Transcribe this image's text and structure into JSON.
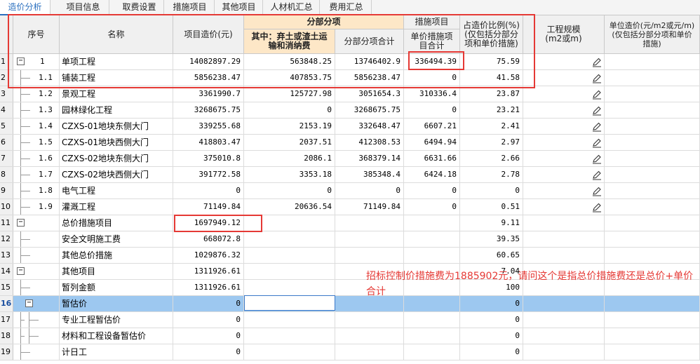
{
  "tabs": [
    {
      "label": "造价分析",
      "active": true
    },
    {
      "label": "项目信息",
      "active": false
    },
    {
      "label": "取费设置",
      "active": false
    },
    {
      "label": "措施项目",
      "active": false
    },
    {
      "label": "其他项目",
      "active": false
    },
    {
      "label": "人材机汇总",
      "active": false
    },
    {
      "label": "费用汇总",
      "active": false
    }
  ],
  "headers": {
    "seq": "序号",
    "name": "名称",
    "project_cost": "项目造价(元)",
    "fbfx_group": "分部分项",
    "fbfx_sub1": "其中：弃土或渣土运输和消纳费",
    "fbfx_sub2": "分部分项合计",
    "measure_group": "措施项目",
    "measure_sub": "单价措施项目合计",
    "ratio": "占造价比例(%)(仅包括分部分项和单价措施)",
    "scale": "工程规模(m2或m)",
    "unit_cost": "单位造价(元/m2或元/m)(仅包括分部分项和单价措施)"
  },
  "rows": [
    {
      "n": "1",
      "seq": "1",
      "name": "单项工程",
      "cost": "14082897.29",
      "qitu": "563848.25",
      "fbfx": "13746402.9",
      "measure": "336494.39",
      "ratio": "75.59",
      "edit": true,
      "toggle": "−",
      "level": 0
    },
    {
      "n": "2",
      "seq": "1.1",
      "name": "铺装工程",
      "cost": "5856238.47",
      "qitu": "407853.75",
      "fbfx": "5856238.47",
      "measure": "0",
      "ratio": "41.58",
      "edit": true,
      "level": 1
    },
    {
      "n": "3",
      "seq": "1.2",
      "name": "景观工程",
      "cost": "3361990.7",
      "qitu": "125727.98",
      "fbfx": "3051654.3",
      "measure": "310336.4",
      "ratio": "23.87",
      "edit": true,
      "level": 1
    },
    {
      "n": "4",
      "seq": "1.3",
      "name": "园林绿化工程",
      "cost": "3268675.75",
      "qitu": "0",
      "fbfx": "3268675.75",
      "measure": "0",
      "ratio": "23.21",
      "edit": true,
      "level": 1
    },
    {
      "n": "5",
      "seq": "1.4",
      "name": "CZXS-01地块东侧大门",
      "cost": "339255.68",
      "qitu": "2153.19",
      "fbfx": "332648.47",
      "measure": "6607.21",
      "ratio": "2.41",
      "edit": true,
      "level": 1
    },
    {
      "n": "6",
      "seq": "1.5",
      "name": "CZXS-01地块西侧大门",
      "cost": "418803.47",
      "qitu": "2037.51",
      "fbfx": "412308.53",
      "measure": "6494.94",
      "ratio": "2.97",
      "edit": true,
      "level": 1
    },
    {
      "n": "7",
      "seq": "1.6",
      "name": "CZXS-02地块东侧大门",
      "cost": "375010.8",
      "qitu": "2086.1",
      "fbfx": "368379.14",
      "measure": "6631.66",
      "ratio": "2.66",
      "edit": true,
      "level": 1
    },
    {
      "n": "8",
      "seq": "1.7",
      "name": "CZXS-02地块西侧大门",
      "cost": "391772.58",
      "qitu": "3353.18",
      "fbfx": "385348.4",
      "measure": "6424.18",
      "ratio": "2.78",
      "edit": true,
      "level": 1
    },
    {
      "n": "9",
      "seq": "1.8",
      "name": "电气工程",
      "cost": "0",
      "qitu": "0",
      "fbfx": "0",
      "measure": "0",
      "ratio": "0",
      "edit": true,
      "level": 1
    },
    {
      "n": "10",
      "seq": "1.9",
      "name": "灌溉工程",
      "cost": "71149.84",
      "qitu": "20636.54",
      "fbfx": "71149.84",
      "measure": "0",
      "ratio": "0.51",
      "edit": true,
      "level": 1
    },
    {
      "n": "11",
      "seq": "",
      "name": "总价措施项目",
      "cost": "1697949.12",
      "qitu": "",
      "fbfx": "",
      "measure": "",
      "ratio": "9.11",
      "edit": false,
      "toggle": "−",
      "level": 0
    },
    {
      "n": "12",
      "seq": "",
      "name": "安全文明施工费",
      "cost": "668072.8",
      "qitu": "",
      "fbfx": "",
      "measure": "",
      "ratio": "39.35",
      "edit": false,
      "level": 1
    },
    {
      "n": "13",
      "seq": "",
      "name": "其他总价措施",
      "cost": "1029876.32",
      "qitu": "",
      "fbfx": "",
      "measure": "",
      "ratio": "60.65",
      "edit": false,
      "level": 1
    },
    {
      "n": "14",
      "seq": "",
      "name": "其他项目",
      "cost": "1311926.61",
      "qitu": "",
      "fbfx": "",
      "measure": "",
      "ratio": "7.04",
      "edit": false,
      "toggle": "−",
      "level": 0
    },
    {
      "n": "15",
      "seq": "",
      "name": "暂列金额",
      "cost": "1311926.61",
      "qitu": "",
      "fbfx": "",
      "measure": "",
      "ratio": "100",
      "edit": false,
      "level": 1
    },
    {
      "n": "16",
      "seq": "",
      "name": "暂估价",
      "cost": "0",
      "qitu": "",
      "fbfx": "",
      "measure": "",
      "ratio": "0",
      "edit": false,
      "toggle": "−",
      "level": 1,
      "selected": true
    },
    {
      "n": "17",
      "seq": "",
      "name": "专业工程暂估价",
      "cost": "0",
      "qitu": "",
      "fbfx": "",
      "measure": "",
      "ratio": "0",
      "edit": false,
      "level": 2
    },
    {
      "n": "18",
      "seq": "",
      "name": "材料和工程设备暂估价",
      "cost": "0",
      "qitu": "",
      "fbfx": "",
      "measure": "",
      "ratio": "0",
      "edit": false,
      "level": 2
    },
    {
      "n": "19",
      "seq": "",
      "name": "计日工",
      "cost": "0",
      "qitu": "",
      "fbfx": "",
      "measure": "",
      "ratio": "0",
      "edit": false,
      "level": 1
    }
  ],
  "annotation": "招标控制价措施费为1885902元，请问这个是指总价措施费还是总价+单价合计",
  "colors": {
    "accent": "#2a6fbf",
    "annotation": "#e53935",
    "selected_row": "#9dc8f0",
    "header_orange": "#fde7c7"
  }
}
